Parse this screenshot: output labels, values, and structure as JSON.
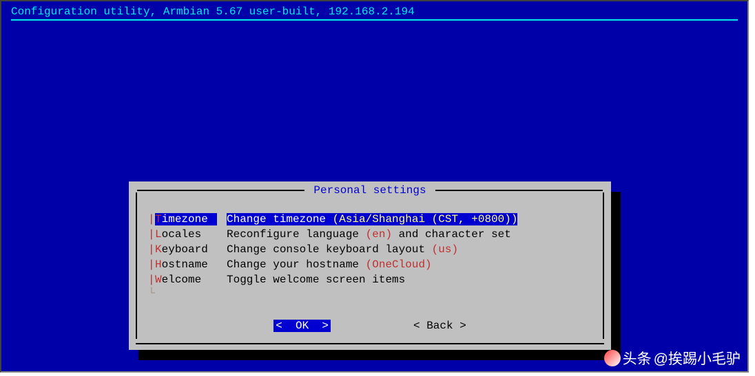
{
  "header": {
    "title": "Configuration utility, Armbian 5.67 user-built, 192.168.2.194"
  },
  "dialog": {
    "title": " Personal settings ",
    "items": [
      {
        "hotkey": "T",
        "rest": "imezone",
        "desc_before": "Change timezone ",
        "desc_paren": "(Asia/Shanghai (CST, +0800))",
        "desc_after": "",
        "selected": true
      },
      {
        "hotkey": "L",
        "rest": "ocales",
        "desc_before": "Reconfigure language ",
        "desc_paren": "(en)",
        "desc_after": " and character set",
        "selected": false
      },
      {
        "hotkey": "K",
        "rest": "eyboard",
        "desc_before": "Change console keyboard layout ",
        "desc_paren": "(us)",
        "desc_after": "",
        "selected": false
      },
      {
        "hotkey": "H",
        "rest": "ostname",
        "desc_before": "Change your hostname ",
        "desc_paren": "(OneCloud)",
        "desc_after": "",
        "selected": false
      },
      {
        "hotkey": "W",
        "rest": "elcome",
        "desc_before": "Toggle welcome screen items",
        "desc_paren": "",
        "desc_after": "",
        "selected": false
      }
    ],
    "buttons": {
      "ok": "<  OK  >",
      "back": "< Back >"
    }
  },
  "watermark": {
    "prefix": "头条",
    "handle": "@挨踢小毛驴"
  }
}
